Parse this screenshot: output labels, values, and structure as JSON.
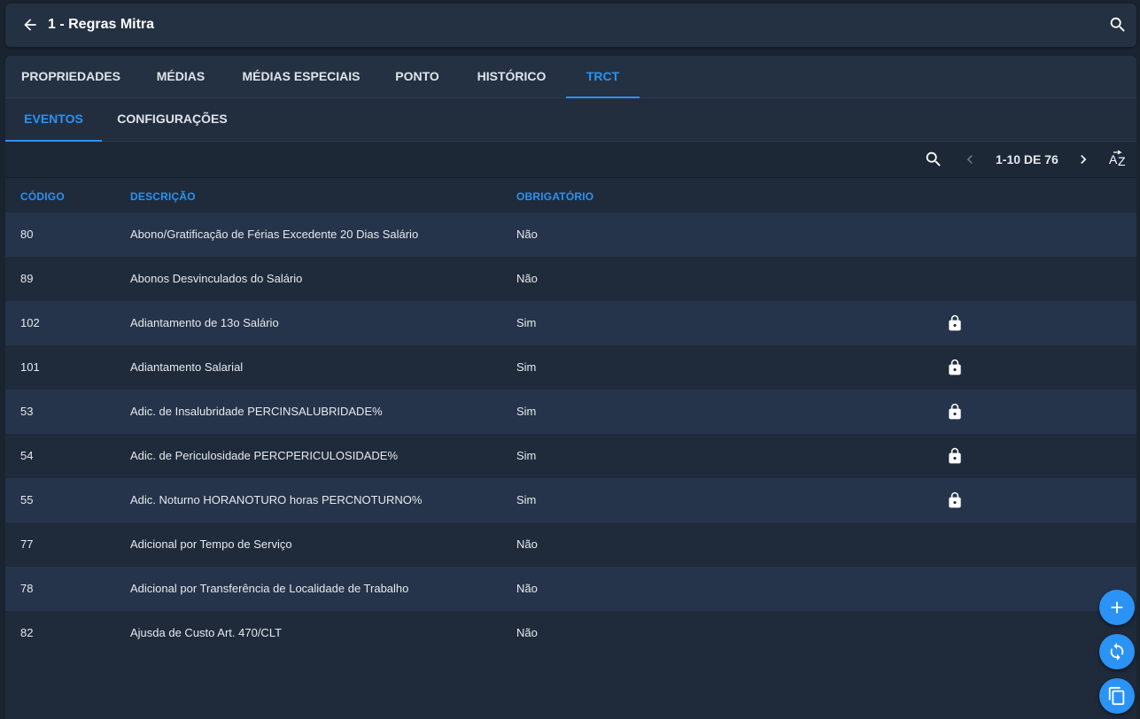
{
  "header": {
    "title": "1 - Regras Mitra",
    "back_icon": "arrow-left-icon",
    "search_icon": "search-icon"
  },
  "tabs": [
    {
      "label": "PROPRIEDADES"
    },
    {
      "label": "MÉDIAS"
    },
    {
      "label": "MÉDIAS ESPECIAIS"
    },
    {
      "label": "PONTO"
    },
    {
      "label": "HISTÓRICO"
    },
    {
      "label": "TRCT",
      "active": true
    }
  ],
  "subtabs": [
    {
      "label": "EVENTOS",
      "active": true
    },
    {
      "label": "CONFIGURAÇÕES"
    }
  ],
  "toolbar": {
    "pager_text": "1-10 DE 76",
    "sort_label": "AZ"
  },
  "table": {
    "columns": [
      "CÓDIGO",
      "DESCRIÇÃO",
      "OBRIGATÓRIO"
    ],
    "rows": [
      {
        "code": "80",
        "description": "Abono/Gratificação de Férias Excedente 20 Dias Salário",
        "required": "Não",
        "locked": false
      },
      {
        "code": "89",
        "description": "Abonos Desvinculados do Salário",
        "required": "Não",
        "locked": false
      },
      {
        "code": "102",
        "description": "Adiantamento de 13o Salário",
        "required": "Sim",
        "locked": true
      },
      {
        "code": "101",
        "description": "Adiantamento Salarial",
        "required": "Sim",
        "locked": true
      },
      {
        "code": "53",
        "description": "Adic. de Insalubridade PERCINSALUBRIDADE%",
        "required": "Sim",
        "locked": true
      },
      {
        "code": "54",
        "description": "Adic. de Periculosidade PERCPERICULOSIDADE%",
        "required": "Sim",
        "locked": true
      },
      {
        "code": "55",
        "description": "Adic. Noturno HORANOTURO horas PERCNOTURNO%",
        "required": "Sim",
        "locked": true
      },
      {
        "code": "77",
        "description": "Adicional por Tempo de Serviço",
        "required": "Não",
        "locked": false
      },
      {
        "code": "78",
        "description": "Adicional por Transferência de Localidade de Trabalho",
        "required": "Não",
        "locked": false
      },
      {
        "code": "82",
        "description": "Ajusda de Custo Art. 470/CLT",
        "required": "Não",
        "locked": false
      }
    ]
  },
  "colors": {
    "accent": "#2a93f5",
    "background": "#1a2330",
    "row_alt": "#25344a"
  }
}
